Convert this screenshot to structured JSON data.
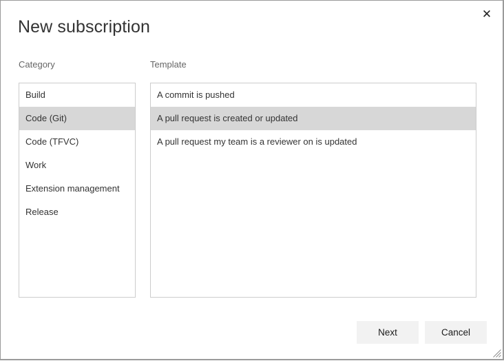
{
  "window": {
    "title": "New subscription",
    "close_icon": "close-icon",
    "close_glyph": "✕",
    "resize_grip_icon": "resize-grip-icon",
    "border_color": "#9a9a9a",
    "background_color": "#ffffff"
  },
  "fields": {
    "category_label": "Category",
    "template_label": "Template"
  },
  "category_list": {
    "selected_index": 1,
    "items": [
      {
        "label": "Build"
      },
      {
        "label": "Code (Git)"
      },
      {
        "label": "Code (TFVC)"
      },
      {
        "label": "Work"
      },
      {
        "label": "Extension management"
      },
      {
        "label": "Release"
      }
    ]
  },
  "template_list": {
    "selected_index": 1,
    "items": [
      {
        "label": "A commit is pushed"
      },
      {
        "label": "A pull request is created or updated"
      },
      {
        "label": "A pull request my team is a reviewer on is updated"
      }
    ]
  },
  "footer": {
    "next_label": "Next",
    "cancel_label": "Cancel"
  },
  "colors": {
    "selection": "#d7d7d7",
    "listbox_border": "#cccccc",
    "button_fill": "#f2f2f2",
    "label_text": "#666666",
    "body_text": "#333333"
  }
}
